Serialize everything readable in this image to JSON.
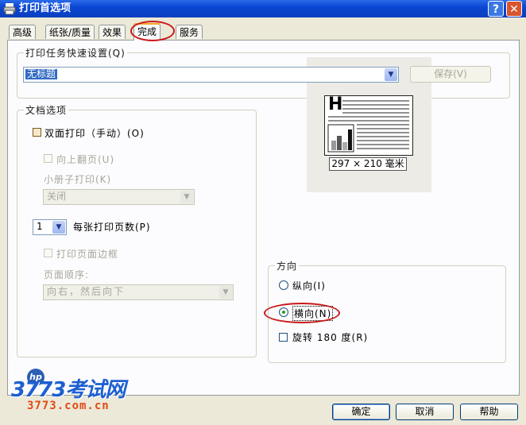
{
  "window": {
    "title": "打印首选项",
    "help_glyph": "?",
    "close_glyph": "✕"
  },
  "tabs": [
    {
      "label": "高级"
    },
    {
      "label": "纸张/质量"
    },
    {
      "label": "效果"
    },
    {
      "label": "完成",
      "active": true
    },
    {
      "label": "服务"
    }
  ],
  "quick_set": {
    "legend": "打印任务快速设置(Q)",
    "selected": "无标题",
    "save_label": "保存(V)"
  },
  "doc_options": {
    "legend": "文档选项",
    "duplex_label": "双面打印（手动）(O)",
    "flip_up_label": "向上翻页(U)",
    "booklet_label": "小册子打印(K)",
    "booklet_value": "关闭",
    "pages_per_sheet_value": "1",
    "pages_per_sheet_label": "每张打印页数(P)",
    "print_borders_label": "打印页面边框",
    "page_order_label": "页面顺序:",
    "page_order_value": "向右，然后向下"
  },
  "preview": {
    "letter": "H",
    "size_label": "297 × 210 毫米"
  },
  "orientation": {
    "legend": "方向",
    "portrait_label": "纵向(I)",
    "landscape_label": "横向(N)",
    "rotate_label": "旋转 180 度(R)",
    "selected": "landscape"
  },
  "footer": {
    "ok_label": "确定",
    "cancel_label": "取消",
    "help_label": "帮助"
  },
  "watermark": {
    "brand": "3773考试网",
    "url": "3773.com.cn",
    "hp": "hp"
  },
  "colors": {
    "titlebar": "#0a46d3",
    "annotation_red": "#c8191a",
    "watermark_blue": "#1d5fd1",
    "watermark_orange": "#e04a14"
  }
}
